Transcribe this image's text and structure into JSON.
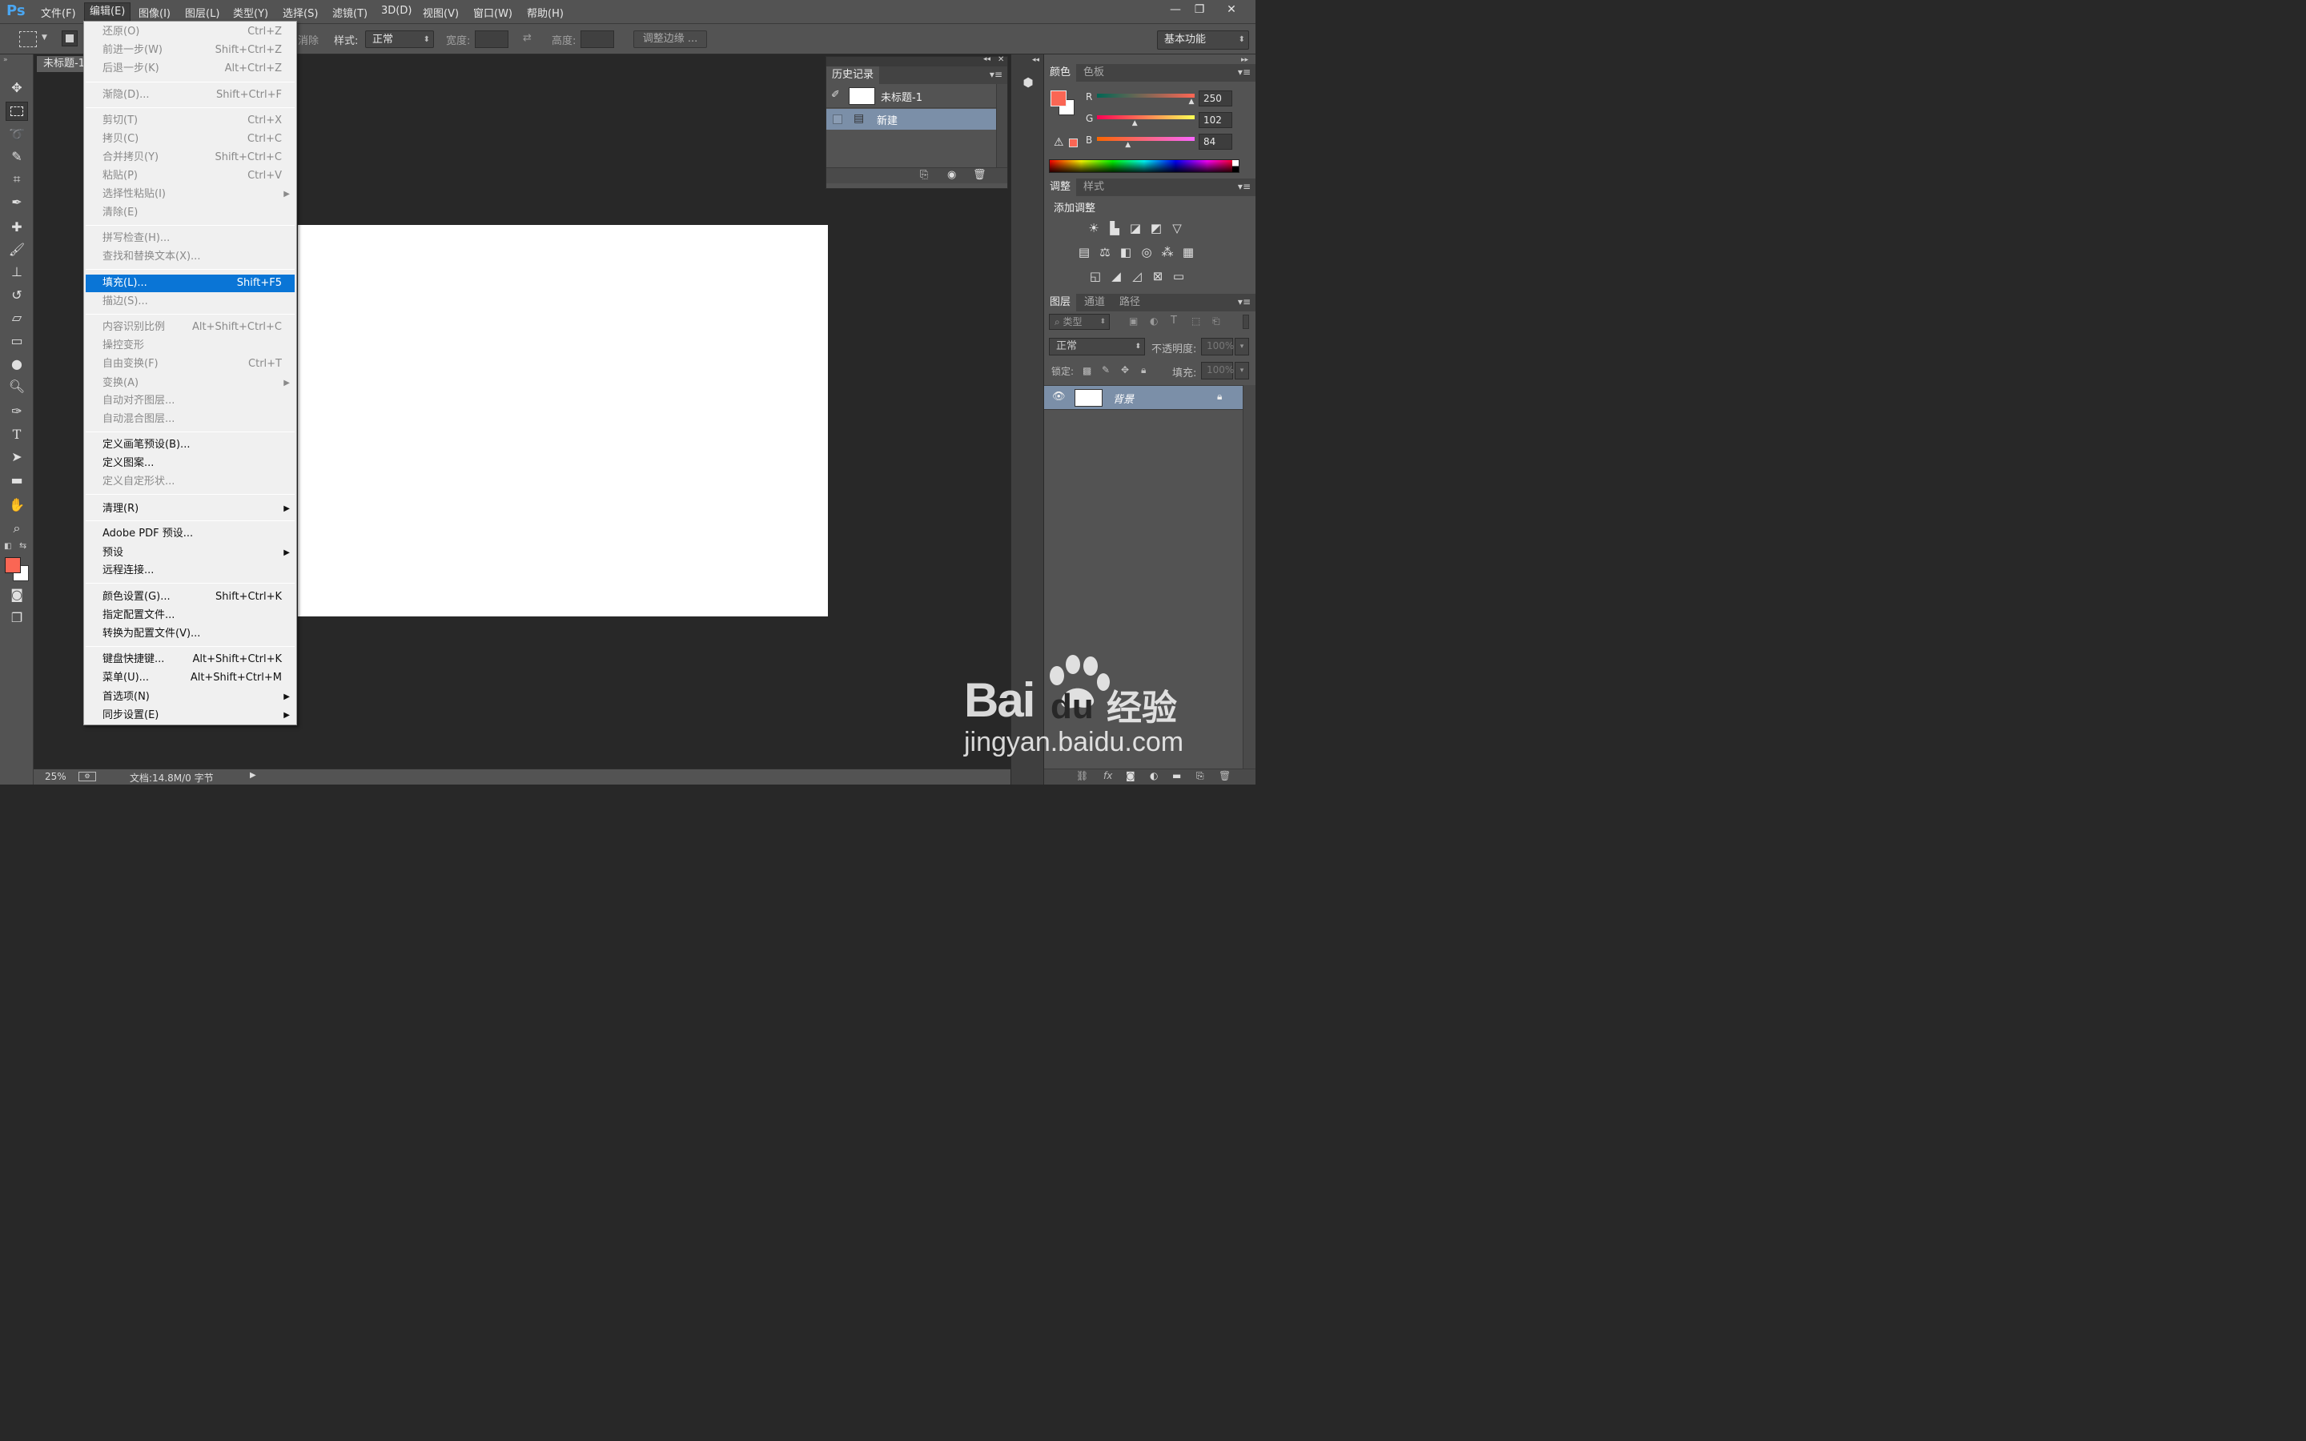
{
  "app": {
    "logo": "Ps",
    "menus": [
      "文件(F)",
      "编辑(E)",
      "图像(I)",
      "图层(L)",
      "类型(Y)",
      "选择(S)",
      "滤镜(T)",
      "3D(D)",
      "视图(V)",
      "窗口(W)",
      "帮助(H)"
    ],
    "window_controls": [
      "—",
      "❐",
      "✕"
    ]
  },
  "options_bar": {
    "anti_alias_partial": "消除",
    "style_label": "样式:",
    "style_value": "正常",
    "width_label": "宽度:",
    "height_label": "高度:",
    "refine_edge": "调整边缘 ...",
    "workspace": "基本功能"
  },
  "document": {
    "tab_title": "未标题-1",
    "zoom": "25%",
    "doc_info": "文档:14.8M/0 字节"
  },
  "edit_menu": {
    "items": [
      {
        "label": "还原(O)",
        "shortcut": "Ctrl+Z"
      },
      {
        "label": "前进一步(W)",
        "shortcut": "Shift+Ctrl+Z"
      },
      {
        "label": "后退一步(K)",
        "shortcut": "Alt+Ctrl+Z"
      },
      {
        "label": "渐隐(D)...",
        "shortcut": "Shift+Ctrl+F"
      },
      {
        "label": "剪切(T)",
        "shortcut": "Ctrl+X"
      },
      {
        "label": "拷贝(C)",
        "shortcut": "Ctrl+C"
      },
      {
        "label": "合并拷贝(Y)",
        "shortcut": "Shift+Ctrl+C"
      },
      {
        "label": "粘贴(P)",
        "shortcut": "Ctrl+V"
      },
      {
        "label": "选择性粘贴(I)",
        "shortcut": ""
      },
      {
        "label": "清除(E)",
        "shortcut": ""
      },
      {
        "label": "拼写检查(H)...",
        "shortcut": ""
      },
      {
        "label": "查找和替换文本(X)...",
        "shortcut": ""
      },
      {
        "label": "填充(L)...",
        "shortcut": "Shift+F5"
      },
      {
        "label": "描边(S)...",
        "shortcut": ""
      },
      {
        "label": "内容识别比例",
        "shortcut": "Alt+Shift+Ctrl+C"
      },
      {
        "label": "操控变形",
        "shortcut": ""
      },
      {
        "label": "自由变换(F)",
        "shortcut": "Ctrl+T"
      },
      {
        "label": "变换(A)",
        "shortcut": ""
      },
      {
        "label": "自动对齐图层...",
        "shortcut": ""
      },
      {
        "label": "自动混合图层...",
        "shortcut": ""
      },
      {
        "label": "定义画笔预设(B)...",
        "shortcut": ""
      },
      {
        "label": "定义图案...",
        "shortcut": ""
      },
      {
        "label": "定义自定形状...",
        "shortcut": ""
      },
      {
        "label": "清理(R)",
        "shortcut": ""
      },
      {
        "label": "Adobe PDF 预设...",
        "shortcut": ""
      },
      {
        "label": "预设",
        "shortcut": ""
      },
      {
        "label": "远程连接...",
        "shortcut": ""
      },
      {
        "label": "颜色设置(G)...",
        "shortcut": "Shift+Ctrl+K"
      },
      {
        "label": "指定配置文件...",
        "shortcut": ""
      },
      {
        "label": "转换为配置文件(V)...",
        "shortcut": ""
      },
      {
        "label": "键盘快捷键...",
        "shortcut": "Alt+Shift+Ctrl+K"
      },
      {
        "label": "菜单(U)...",
        "shortcut": "Alt+Shift+Ctrl+M"
      },
      {
        "label": "首选项(N)",
        "shortcut": ""
      },
      {
        "label": "同步设置(E)",
        "shortcut": ""
      }
    ]
  },
  "history_panel": {
    "tab": "历史记录",
    "snapshot": "未标题-1",
    "step": "新建"
  },
  "color_panel": {
    "tabs": [
      "颜色",
      "色板"
    ],
    "r_label": "R",
    "g_label": "G",
    "b_label": "B",
    "r": "250",
    "g": "102",
    "b": "84",
    "foreground": "#fa6654",
    "r_level": 0.98,
    "g_level": 0.4,
    "b_level": 0.33
  },
  "adjustments_panel": {
    "tabs": [
      "调整",
      "样式"
    ],
    "heading": "添加调整"
  },
  "layers_panel": {
    "tabs": [
      "图层",
      "通道",
      "路径"
    ],
    "filter_kind": "类型",
    "blend_mode": "正常",
    "opacity_label": "不透明度:",
    "opacity": "100%",
    "lock_label": "锁定:",
    "fill_label": "填充:",
    "fill": "100%",
    "layer_name": "背景"
  },
  "watermark": {
    "brand": "Bai",
    "brand2": "du",
    "cn": "经验",
    "url": "jingyan.baidu.com"
  }
}
